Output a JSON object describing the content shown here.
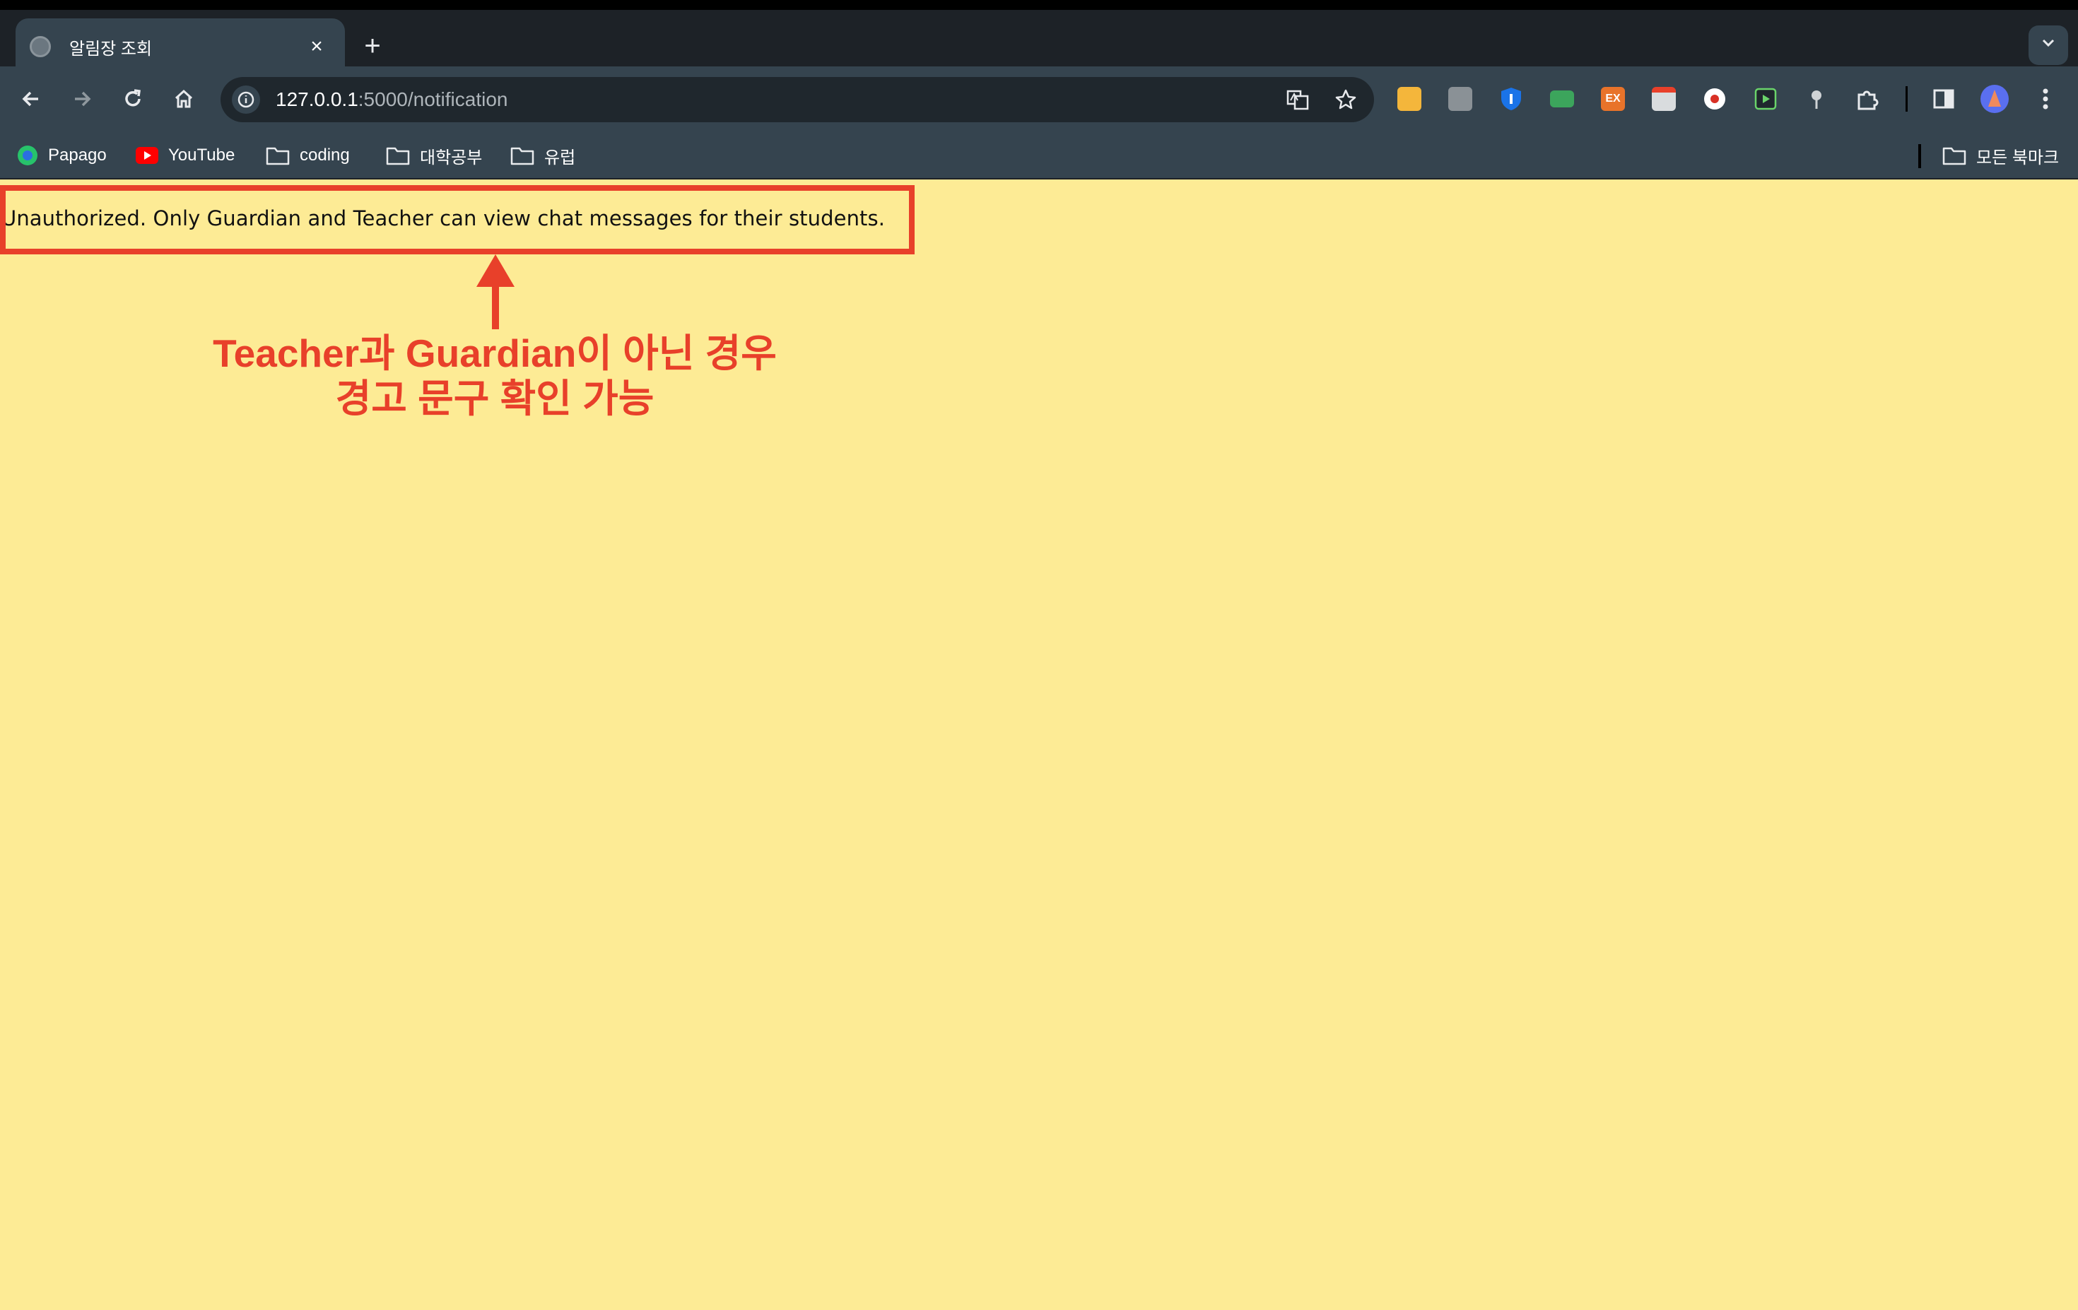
{
  "browser": {
    "tab": {
      "title": "알림장 조회",
      "close_symbol": "×"
    },
    "new_tab_symbol": "+",
    "address": {
      "host": "127.0.0.1",
      "path": ":5000/notification"
    },
    "bookmarks": [
      {
        "label": "Papago",
        "icon": "papago-icon"
      },
      {
        "label": "YouTube",
        "icon": "youtube-icon"
      },
      {
        "label": "coding",
        "icon": "folder-icon"
      },
      {
        "label": "대학공부",
        "icon": "folder-icon"
      },
      {
        "label": "유럽",
        "icon": "folder-icon"
      }
    ],
    "all_bookmarks": "모든 북마크",
    "extensions": [
      "yellow-ext-icon",
      "gray-ext-icon",
      "shield-ext-icon",
      "green-ext-icon",
      "ex-ext-icon",
      "printer-ext-icon",
      "record-ext-icon",
      "play-ext-icon",
      "pin-ext-icon",
      "puzzle-icon"
    ],
    "ex_label": "EX"
  },
  "page": {
    "alert_message": "Unauthorized. Only Guardian and Teacher can view chat messages for their students."
  },
  "annotation": {
    "line1": "Teacher과 Guardian이 아닌 경우",
    "line2": "경고 문구 확인 가능",
    "color": "#e8402a"
  },
  "colors": {
    "page_background": "#fdeb95",
    "chrome_toolbar": "#35444f",
    "tabstrip": "#1d2227"
  }
}
